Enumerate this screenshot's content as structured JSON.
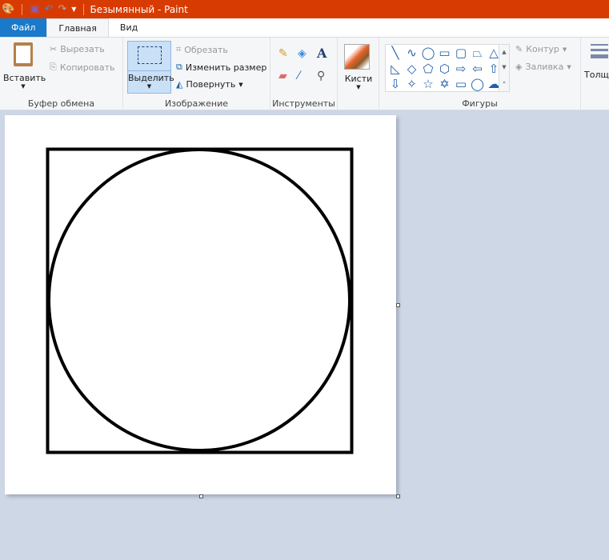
{
  "window": {
    "title": "Безымянный - Paint",
    "accent": "#d83b01"
  },
  "tabs": [
    {
      "label": "Файл"
    },
    {
      "label": "Главная"
    },
    {
      "label": "Вид"
    }
  ],
  "clipboard": {
    "paste": "Вставить",
    "cut": "Вырезать",
    "copy": "Копировать",
    "label": "Буфер обмена"
  },
  "image": {
    "select": "Выделить",
    "crop": "Обрезать",
    "resize": "Изменить размер",
    "rotate": "Повернуть",
    "label": "Изображение"
  },
  "tools": {
    "label": "Инструменты"
  },
  "brushes": {
    "label": "Кисти"
  },
  "shapes": {
    "label": "Фигуры",
    "outline": "Контур",
    "fill": "Заливка",
    "items": [
      "╲",
      "∿",
      "◯",
      "▭",
      "▢",
      "⏢",
      "△",
      "◺",
      "◇",
      "⬠",
      "⬡",
      "⇨",
      "⇦",
      "⇧",
      "⇩",
      "✧",
      "☆",
      "✡",
      "▭",
      "◯",
      "☁"
    ]
  },
  "size": {
    "label": "Толщ"
  }
}
